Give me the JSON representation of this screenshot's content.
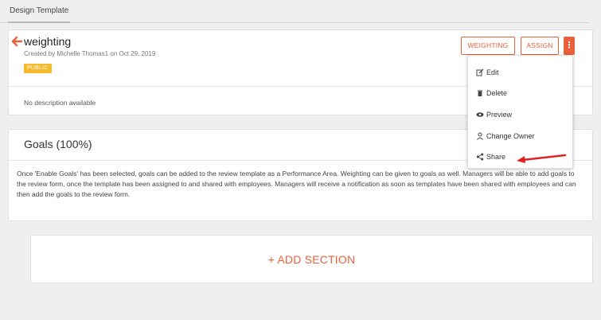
{
  "tabs": {
    "active_label": "Design Template"
  },
  "template": {
    "title": "weighting",
    "meta": "Created by Michelle Thomas1 on Oct 29, 2019",
    "badge": "PUBLIC",
    "description": "No description available"
  },
  "actions": {
    "weighting_label": "WEIGHTING",
    "assign_label": "ASSIGN",
    "more_label": "⋮"
  },
  "menu": {
    "items": [
      {
        "label": "Edit",
        "icon": "edit-icon"
      },
      {
        "label": "Delete",
        "icon": "trash-icon"
      },
      {
        "label": "Preview",
        "icon": "eye-icon"
      },
      {
        "label": "Change Owner",
        "icon": "user-icon"
      },
      {
        "label": "Share",
        "icon": "share-icon"
      }
    ]
  },
  "goals": {
    "title": "Goals (100%)",
    "text": "Once 'Enable Goals' has been selected, goals can be added to the review template as a Performance Area. Weighting can be given to goals as well. Managers will be able to add goals to the review form, once the template has been assigned to and shared with employees. Managers will receive a notification as soon as templates have been shared with employees and can then add the goals to the review form."
  },
  "add_section": {
    "label": "+ ADD SECTION"
  },
  "colors": {
    "accent": "#e8613a",
    "badge": "#f6b92a",
    "annotation": "#e32222"
  }
}
